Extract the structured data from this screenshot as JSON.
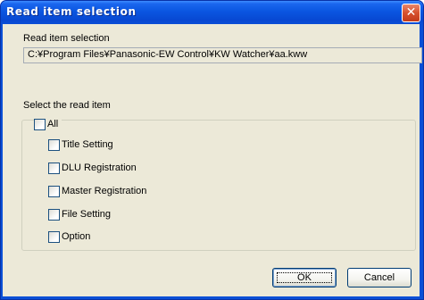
{
  "window": {
    "title": "Read item selection",
    "close_symbol": "✕"
  },
  "section": {
    "read_item_label": "Read item selection",
    "file_path": "C:¥Program Files¥Panasonic-EW Control¥KW Watcher¥aa.kww",
    "select_label": "Select the read item"
  },
  "items": {
    "all": {
      "label": "All",
      "checked": false
    },
    "list": [
      {
        "label": "Title Setting",
        "checked": false
      },
      {
        "label": "DLU Registration",
        "checked": false
      },
      {
        "label": "Master Registration",
        "checked": false
      },
      {
        "label": "File Setting",
        "checked": false
      },
      {
        "label": "Option",
        "checked": false
      }
    ]
  },
  "buttons": {
    "ok_label": "OK",
    "cancel_label": "Cancel"
  },
  "colors": {
    "titlebar": "#0a55e0",
    "client_background": "#ece9d8",
    "close_button": "#d6502e"
  }
}
